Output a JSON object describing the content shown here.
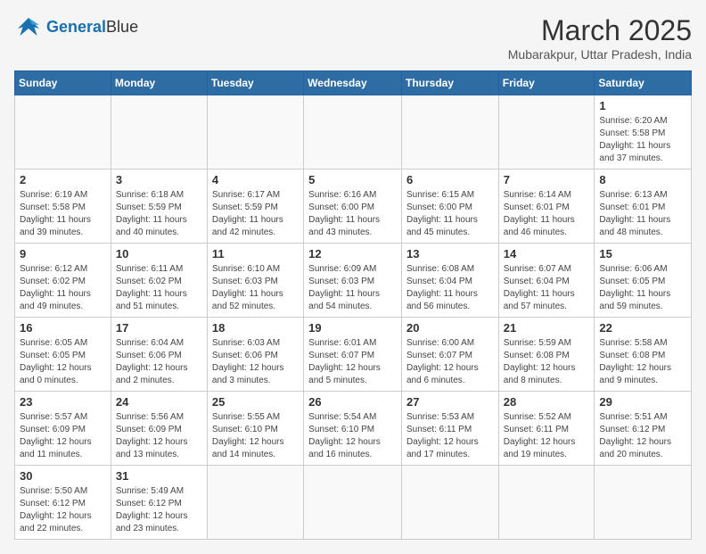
{
  "header": {
    "logo_general": "General",
    "logo_blue": "Blue",
    "month_title": "March 2025",
    "location": "Mubarakpur, Uttar Pradesh, India"
  },
  "days_of_week": [
    "Sunday",
    "Monday",
    "Tuesday",
    "Wednesday",
    "Thursday",
    "Friday",
    "Saturday"
  ],
  "weeks": [
    [
      null,
      null,
      null,
      null,
      null,
      null,
      {
        "day": 1,
        "sunrise": "6:20 AM",
        "sunset": "5:58 PM",
        "daylight": "11 hours and 37 minutes."
      }
    ],
    [
      {
        "day": 2,
        "sunrise": "6:19 AM",
        "sunset": "5:58 PM",
        "daylight": "11 hours and 39 minutes."
      },
      {
        "day": 3,
        "sunrise": "6:18 AM",
        "sunset": "5:59 PM",
        "daylight": "11 hours and 40 minutes."
      },
      {
        "day": 4,
        "sunrise": "6:17 AM",
        "sunset": "5:59 PM",
        "daylight": "11 hours and 42 minutes."
      },
      {
        "day": 5,
        "sunrise": "6:16 AM",
        "sunset": "6:00 PM",
        "daylight": "11 hours and 43 minutes."
      },
      {
        "day": 6,
        "sunrise": "6:15 AM",
        "sunset": "6:00 PM",
        "daylight": "11 hours and 45 minutes."
      },
      {
        "day": 7,
        "sunrise": "6:14 AM",
        "sunset": "6:01 PM",
        "daylight": "11 hours and 46 minutes."
      },
      {
        "day": 8,
        "sunrise": "6:13 AM",
        "sunset": "6:01 PM",
        "daylight": "11 hours and 48 minutes."
      }
    ],
    [
      {
        "day": 9,
        "sunrise": "6:12 AM",
        "sunset": "6:02 PM",
        "daylight": "11 hours and 49 minutes."
      },
      {
        "day": 10,
        "sunrise": "6:11 AM",
        "sunset": "6:02 PM",
        "daylight": "11 hours and 51 minutes."
      },
      {
        "day": 11,
        "sunrise": "6:10 AM",
        "sunset": "6:03 PM",
        "daylight": "11 hours and 52 minutes."
      },
      {
        "day": 12,
        "sunrise": "6:09 AM",
        "sunset": "6:03 PM",
        "daylight": "11 hours and 54 minutes."
      },
      {
        "day": 13,
        "sunrise": "6:08 AM",
        "sunset": "6:04 PM",
        "daylight": "11 hours and 56 minutes."
      },
      {
        "day": 14,
        "sunrise": "6:07 AM",
        "sunset": "6:04 PM",
        "daylight": "11 hours and 57 minutes."
      },
      {
        "day": 15,
        "sunrise": "6:06 AM",
        "sunset": "6:05 PM",
        "daylight": "11 hours and 59 minutes."
      }
    ],
    [
      {
        "day": 16,
        "sunrise": "6:05 AM",
        "sunset": "6:05 PM",
        "daylight": "12 hours and 0 minutes."
      },
      {
        "day": 17,
        "sunrise": "6:04 AM",
        "sunset": "6:06 PM",
        "daylight": "12 hours and 2 minutes."
      },
      {
        "day": 18,
        "sunrise": "6:03 AM",
        "sunset": "6:06 PM",
        "daylight": "12 hours and 3 minutes."
      },
      {
        "day": 19,
        "sunrise": "6:01 AM",
        "sunset": "6:07 PM",
        "daylight": "12 hours and 5 minutes."
      },
      {
        "day": 20,
        "sunrise": "6:00 AM",
        "sunset": "6:07 PM",
        "daylight": "12 hours and 6 minutes."
      },
      {
        "day": 21,
        "sunrise": "5:59 AM",
        "sunset": "6:08 PM",
        "daylight": "12 hours and 8 minutes."
      },
      {
        "day": 22,
        "sunrise": "5:58 AM",
        "sunset": "6:08 PM",
        "daylight": "12 hours and 9 minutes."
      }
    ],
    [
      {
        "day": 23,
        "sunrise": "5:57 AM",
        "sunset": "6:09 PM",
        "daylight": "12 hours and 11 minutes."
      },
      {
        "day": 24,
        "sunrise": "5:56 AM",
        "sunset": "6:09 PM",
        "daylight": "12 hours and 13 minutes."
      },
      {
        "day": 25,
        "sunrise": "5:55 AM",
        "sunset": "6:10 PM",
        "daylight": "12 hours and 14 minutes."
      },
      {
        "day": 26,
        "sunrise": "5:54 AM",
        "sunset": "6:10 PM",
        "daylight": "12 hours and 16 minutes."
      },
      {
        "day": 27,
        "sunrise": "5:53 AM",
        "sunset": "6:11 PM",
        "daylight": "12 hours and 17 minutes."
      },
      {
        "day": 28,
        "sunrise": "5:52 AM",
        "sunset": "6:11 PM",
        "daylight": "12 hours and 19 minutes."
      },
      {
        "day": 29,
        "sunrise": "5:51 AM",
        "sunset": "6:12 PM",
        "daylight": "12 hours and 20 minutes."
      }
    ],
    [
      {
        "day": 30,
        "sunrise": "5:50 AM",
        "sunset": "6:12 PM",
        "daylight": "12 hours and 22 minutes."
      },
      {
        "day": 31,
        "sunrise": "5:49 AM",
        "sunset": "6:12 PM",
        "daylight": "12 hours and 23 minutes."
      },
      null,
      null,
      null,
      null,
      null
    ]
  ]
}
